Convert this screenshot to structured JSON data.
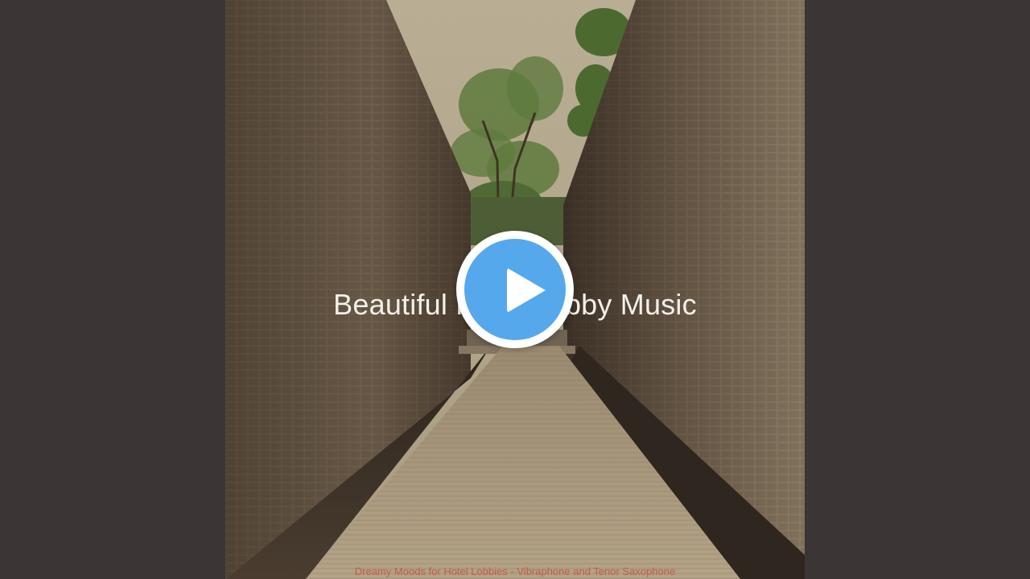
{
  "video": {
    "title_text": "Beautiful Hotel Lobby Music",
    "subtitle_text": "Dreamy Moods for Hotel Lobbies - Vibraphone and Tenor Saxophone",
    "play_icon": "play-icon"
  },
  "colors": {
    "background": "#3b3536",
    "play_button_fill": "#55a8ec",
    "play_button_ring": "#ffffff",
    "title_text": "#f4efe9",
    "subtitle_text": "#c8503f"
  }
}
